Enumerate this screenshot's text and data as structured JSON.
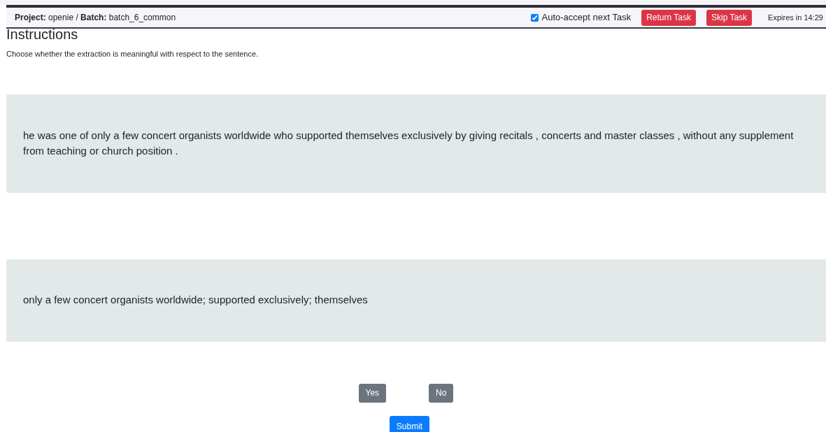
{
  "header": {
    "project_line": "**Project:** openie / **Batch:** batch_6_common",
    "auto_accept": {
      "label": "Auto-accept next Task",
      "checked": true
    },
    "buttons": [
      "Return Task",
      "Skip Task"
    ],
    "expires": "Expires in 14:29"
  },
  "instructions": {
    "title": "Instructions",
    "text": "Choose whether the extraction is meaningful with respect to the sentence."
  },
  "sentence": "he was one of only a few concert organists worldwide who supported themselves exclusively by giving recitals , concerts and master classes , without any supplement from teaching or church position .",
  "extraction": "only a few concert organists worldwide; supported exclusively; themselves",
  "answers": [
    {
      "label": "Yes",
      "selected": false
    },
    {
      "label": "No",
      "selected": false
    }
  ],
  "submit": "Submit"
}
